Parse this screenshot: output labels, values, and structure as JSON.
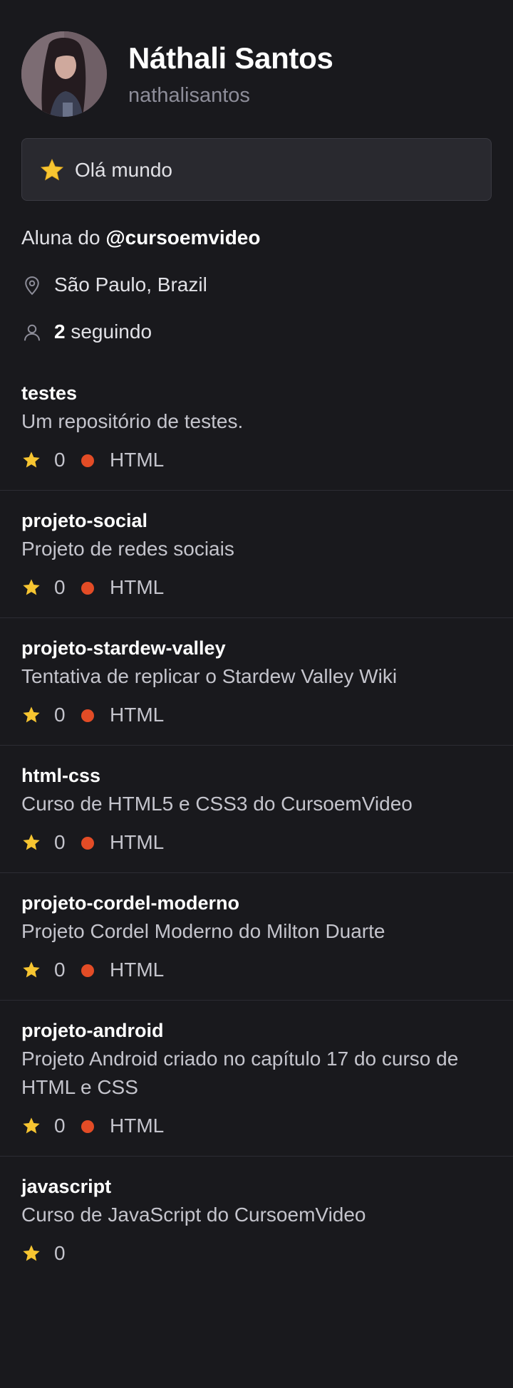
{
  "profile": {
    "name": "Náthali Santos",
    "username": "nathalisantos",
    "avatar_icon": "user-avatar-photo"
  },
  "status": {
    "emoji_icon": "star-icon",
    "text": "Olá mundo"
  },
  "bio": {
    "prefix": "Aluna do ",
    "mention": "@cursoemvideo"
  },
  "location": {
    "icon": "map-pin-icon",
    "text": "São Paulo, Brazil"
  },
  "following": {
    "icon": "person-icon",
    "count": "2",
    "label": " seguindo"
  },
  "colors": {
    "background": "#19191d",
    "status_bg": "#29292f",
    "star": "#f7c531",
    "html_lang": "#e34c26",
    "muted_text": "#8d8d99"
  },
  "repos": [
    {
      "name": "testes",
      "description": "Um repositório de testes.",
      "stars": "0",
      "language": "HTML"
    },
    {
      "name": "projeto-social",
      "description": "Projeto de redes sociais",
      "stars": "0",
      "language": "HTML"
    },
    {
      "name": "projeto-stardew-valley",
      "description": "Tentativa de replicar o Stardew Valley Wiki",
      "stars": "0",
      "language": "HTML"
    },
    {
      "name": "html-css",
      "description": "Curso de HTML5 e CSS3 do CursoemVideo",
      "stars": "0",
      "language": "HTML"
    },
    {
      "name": "projeto-cordel-moderno",
      "description": "Projeto Cordel Moderno do Milton Duarte",
      "stars": "0",
      "language": "HTML"
    },
    {
      "name": "projeto-android",
      "description": "Projeto Android criado no capítulo 17 do curso de HTML e CSS",
      "stars": "0",
      "language": "HTML"
    },
    {
      "name": "javascript",
      "description": "Curso de JavaScript do CursoemVideo",
      "stars": "0",
      "language": ""
    }
  ]
}
